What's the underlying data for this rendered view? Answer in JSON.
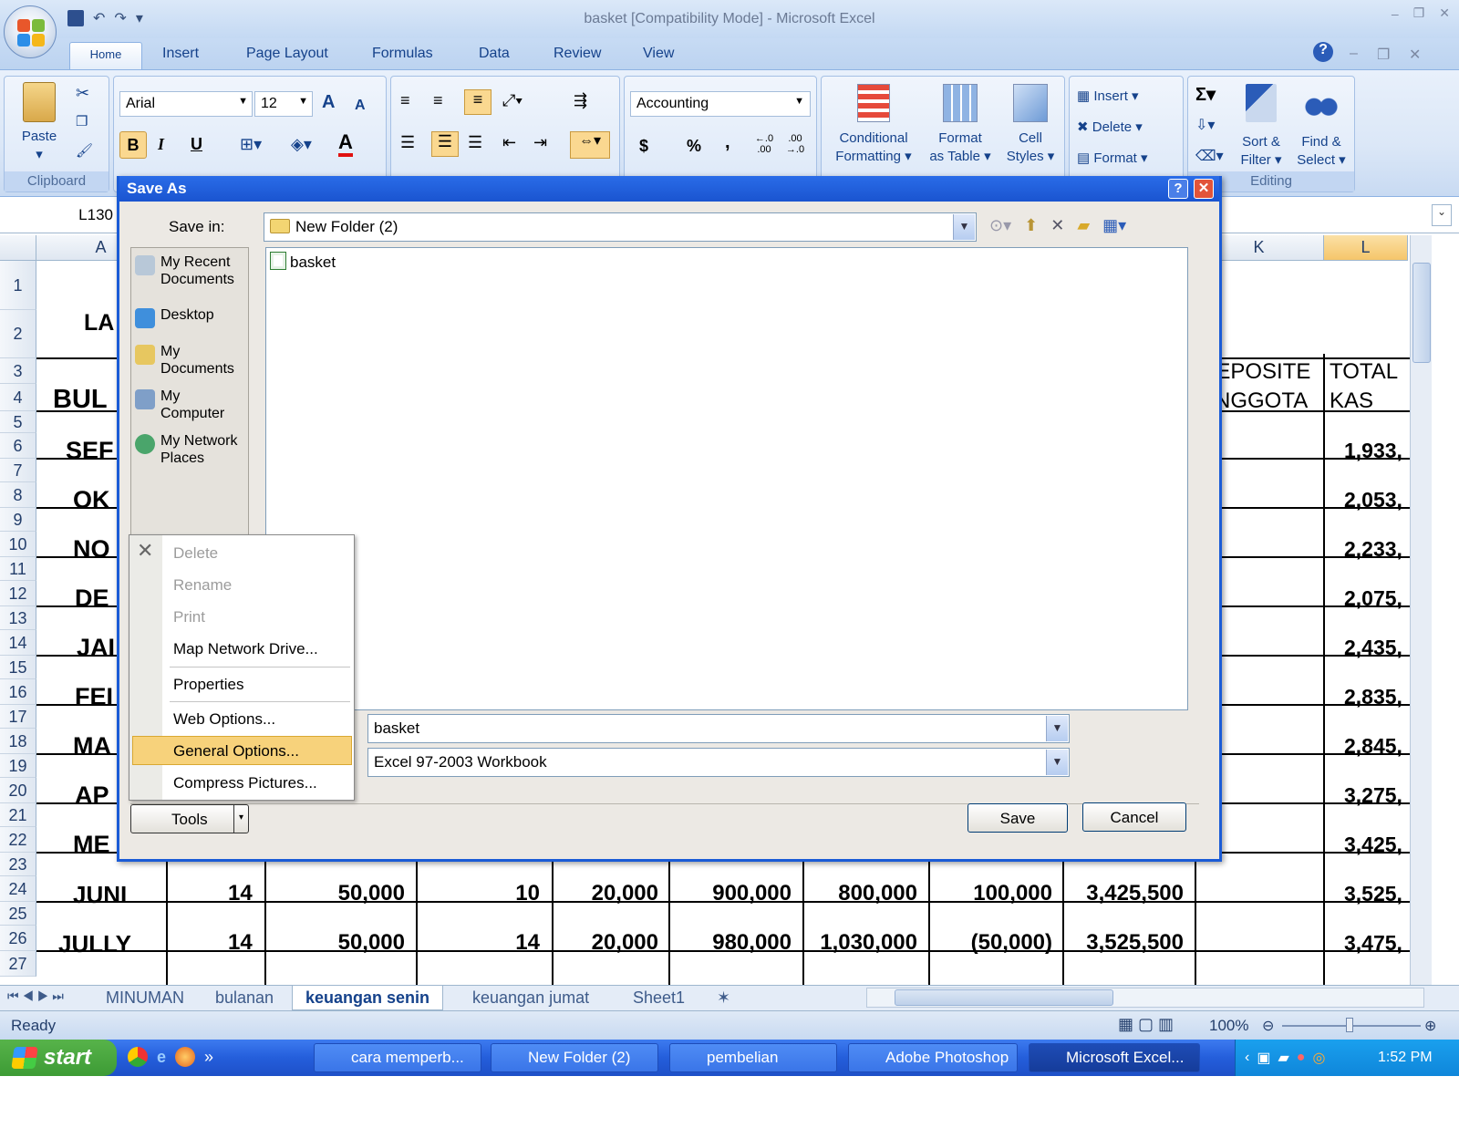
{
  "window": {
    "title": "basket  [Compatibility Mode] - Microsoft Excel",
    "controls": [
      "–",
      "❐",
      "✕"
    ]
  },
  "ribbon_tabs": [
    "Home",
    "Insert",
    "Page Layout",
    "Formulas",
    "Data",
    "Review",
    "View"
  ],
  "ribbon": {
    "clipboard": {
      "paste": "Paste",
      "label": "Clipboard"
    },
    "font": {
      "name": "Arial",
      "size": "12",
      "bold": "B",
      "italic": "I",
      "underline": "U",
      "grow": "A",
      "shrink": "A",
      "font_color": "A"
    },
    "number": {
      "format": "Accounting",
      "currency": "$",
      "percent": "%",
      "comma": ",",
      "inc": "←.0 .00",
      "dec": ".00 →.0"
    },
    "styles": {
      "conditional": "Conditional\nFormatting",
      "conditional_l1": "Conditional",
      "conditional_l2": "Formatting",
      "format_table_l1": "Format",
      "format_table_l2": "as Table",
      "cell_styles_l1": "Cell",
      "cell_styles_l2": "Styles"
    },
    "cells": {
      "insert": "Insert",
      "delete": "Delete",
      "format": "Format"
    },
    "editing": {
      "sigma": "Σ",
      "sort_l1": "Sort &",
      "sort_l2": "Filter",
      "find_l1": "Find &",
      "find_l2": "Select",
      "label": "Editing"
    }
  },
  "formula_bar": {
    "name_box": "L130"
  },
  "columns": {
    "a": "A",
    "k": "K",
    "l": "L"
  },
  "rows": [
    "1",
    "2",
    "3",
    "4",
    "5",
    "6",
    "7",
    "8",
    "9",
    "10",
    "11",
    "12",
    "13",
    "14",
    "15",
    "16",
    "17",
    "18",
    "19",
    "20",
    "21",
    "22",
    "23",
    "24",
    "25",
    "26",
    "27"
  ],
  "sheet": {
    "a2": "LA",
    "a4": "BUL",
    "months_partial": [
      "SEF",
      "OK",
      "NO",
      "DE",
      "JAI",
      "FEI",
      "MA",
      "AP",
      "ME"
    ],
    "header_k1": "DEPOSITE",
    "header_k2": "ANGGOTA",
    "header_l1": "TOTAL",
    "header_l2": "KAS",
    "total_kas": [
      "1,933,",
      "2,053,",
      "2,233,",
      "2,075,",
      "2,435,",
      "2,835,",
      "2,845,",
      "3,275,",
      "3,425,",
      "3,525,",
      "3,475,"
    ],
    "row24": [
      "JUNI",
      "14",
      "50,000",
      "10",
      "20,000",
      "900,000",
      "800,000",
      "100,000",
      "3,425,500"
    ],
    "row26": [
      "JULLY",
      "14",
      "50,000",
      "14",
      "20,000",
      "980,000",
      "1,030,000",
      "(50,000)",
      "3,525,500"
    ]
  },
  "sheet_tabs": [
    "MINUMAN",
    "bulanan",
    "keuangan senin",
    "keuangan jumat",
    "Sheet1"
  ],
  "status": {
    "ready": "Ready",
    "zoom": "100%"
  },
  "dialog": {
    "title": "Save As",
    "save_in_label": "Save in:",
    "save_in_value": "New Folder (2)",
    "places": [
      "My Recent Documents",
      "Desktop",
      "My Documents",
      "My Computer",
      "My Network Places"
    ],
    "places_lines": [
      [
        "My Recent",
        "Documents"
      ],
      [
        "Desktop"
      ],
      [
        "My",
        "Documents"
      ],
      [
        "My",
        "Computer"
      ],
      [
        "My Network",
        "Places"
      ]
    ],
    "files": [
      "basket"
    ],
    "file_name": "basket",
    "file_type": "Excel 97-2003 Workbook",
    "tools_label": "Tools",
    "save_label": "Save",
    "cancel_label": "Cancel",
    "help": "?",
    "close": "✕"
  },
  "tools_menu": {
    "items": [
      "Delete",
      "Rename",
      "Print",
      "Map Network Drive...",
      "Properties",
      "Web Options...",
      "General Options...",
      "Compress Pictures..."
    ],
    "highlighted": "General Options..."
  },
  "taskbar": {
    "start": "start",
    "buttons": [
      "cara memperb...",
      "New Folder (2)",
      "pembelian",
      "Adobe Photoshop",
      "Microsoft Excel..."
    ],
    "clock": "1:52 PM"
  },
  "colors": {
    "title_blue": "#1a54d0",
    "menu_highlight": "#f7d27b",
    "taskbar": "#245edb",
    "start_green": "#3d9b35"
  }
}
